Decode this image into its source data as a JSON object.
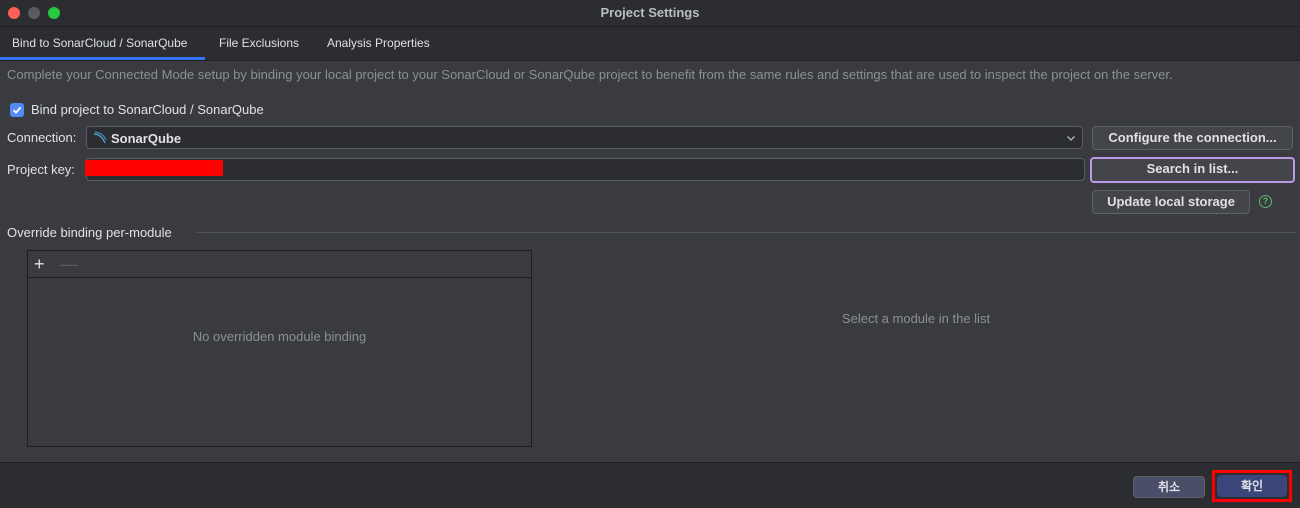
{
  "window": {
    "title": "Project Settings"
  },
  "tabs": [
    {
      "label": "Bind to SonarCloud / SonarQube"
    },
    {
      "label": "File Exclusions"
    },
    {
      "label": "Analysis Properties"
    }
  ],
  "description": "Complete your Connected Mode setup by binding your local project to your SonarCloud or SonarQube project to benefit from the same rules and settings that are used to inspect the project on the server.",
  "bind": {
    "label": "Bind project to SonarCloud / SonarQube",
    "checked": true
  },
  "connection": {
    "label": "Connection:",
    "value": "SonarQube",
    "icon": "sonarqube-icon"
  },
  "configure_button": "Configure the connection...",
  "project_key": {
    "label": "Project key:",
    "value": ""
  },
  "search_button": "Search in list...",
  "update_button": "Update local storage",
  "help_icon": "?",
  "override": {
    "title": "Override binding per-module",
    "add_icon": "+",
    "remove_icon": "—",
    "empty_text": "No overridden module binding",
    "right_empty_text": "Select a module in the list"
  },
  "footer": {
    "cancel": "취소",
    "ok": "확인"
  },
  "colors": {
    "accent": "#3574f0",
    "background": "#393b40",
    "highlight_box": "#ff0000",
    "focus_ring": "#b89ae9"
  }
}
